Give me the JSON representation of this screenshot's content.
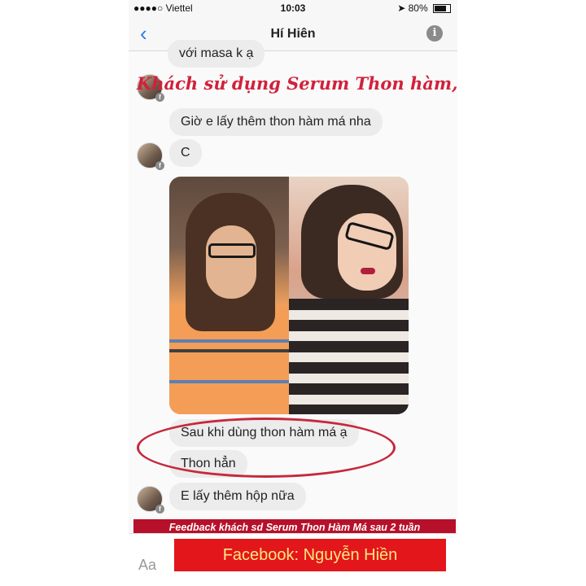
{
  "status_bar": {
    "carrier": "●●●●○ Viettel",
    "time": "10:03",
    "battery": "80%"
  },
  "nav": {
    "title": "Hí Hiên",
    "back_glyph": "‹",
    "info_glyph": "i"
  },
  "messages": [
    {
      "text": "với masa k ạ"
    },
    {
      "text": "Giờ e lấy thêm thon hàm má nha"
    },
    {
      "text": "C"
    },
    {
      "text": "Sau khi dùng thon hàm má ạ"
    },
    {
      "text": "Thon hẳn"
    },
    {
      "text": "E lấy thêm hộp nữa"
    }
  ],
  "overlay_caption": "Khách sử dụng Serum Thon hàm, thon m",
  "composer": {
    "placeholder_glyph": "Aa"
  },
  "banner_feedback": "Feedback khách sd Serum Thon Hàm Má sau 2 tuần",
  "banner_facebook": "Facebook: Nguyễn Hiền",
  "colors": {
    "accent_blue": "#2f7be3",
    "bubble_gray": "#ececec",
    "caption_red": "#d2203b",
    "banner_dark_red": "#b7102a",
    "banner_red": "#e3161b",
    "banner_text_yellow": "#ffe680"
  }
}
